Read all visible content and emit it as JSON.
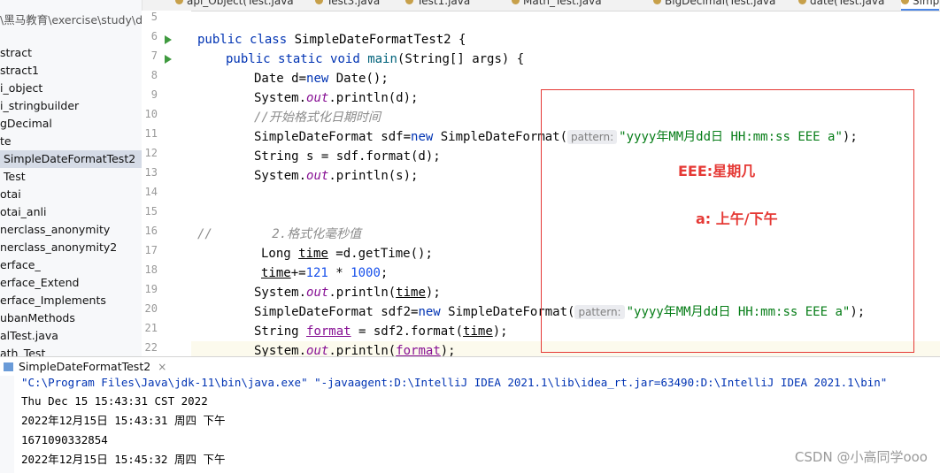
{
  "tabs": [
    {
      "label": "api_Object(Test.java"
    },
    {
      "label": "Test3.java"
    },
    {
      "label": "Test1.java"
    },
    {
      "label": "Math_Test.java"
    },
    {
      "label": "BigDecimal(Test.java"
    },
    {
      "label": "date(Test.java"
    },
    {
      "label": "Simp"
    }
  ],
  "tree": {
    "path": "\\黑马教育\\exercise\\study\\da",
    "items": [
      {
        "label": "stract"
      },
      {
        "label": "stract1"
      },
      {
        "label": "i_object"
      },
      {
        "label": "i_stringbuilder"
      },
      {
        "label": "gDecimal"
      },
      {
        "label": "te"
      },
      {
        "label": "SimpleDateFormatTest2",
        "selected": true
      },
      {
        "label": "Test"
      },
      {
        "label": "otai"
      },
      {
        "label": "otai_anli"
      },
      {
        "label": "nerclass_anonymity"
      },
      {
        "label": "nerclass_anonymity2"
      },
      {
        "label": "erface_"
      },
      {
        "label": "erface_Extend"
      },
      {
        "label": "erface_Implements"
      },
      {
        "label": "ubanMethods"
      },
      {
        "label": "alTest.java"
      },
      {
        "label": "ath_Test"
      }
    ]
  },
  "gutter": {
    "line_numbers": [
      "5",
      "6",
      "7",
      "8",
      "9",
      "10",
      "11",
      "12",
      "13",
      "14",
      "15",
      "16",
      "17",
      "18",
      "19",
      "20",
      "21",
      "22"
    ]
  },
  "code": {
    "l6": {
      "kw1": "public",
      "kw2": "class",
      "name": "SimpleDateFormatTest2",
      "brace": " {"
    },
    "l7": {
      "kw1": "public",
      "kw2": "static",
      "kw3": "void",
      "fn": "main",
      "rest": "(String[] args) {"
    },
    "l8": {
      "a": "Date d=",
      "kw": "new",
      "b": " Date();"
    },
    "l9": {
      "a": "System.",
      "f": "out",
      "b": ".println(d);"
    },
    "l10": {
      "cm": "//开始格式化日期时间"
    },
    "l11": {
      "a": "SimpleDateFormat sdf=",
      "kw": "new",
      "b": " SimpleDateFormat(",
      "hint": "pattern:",
      "s": "\"yyyy年MM月dd日 HH:mm:ss EEE a\"",
      "c": ");"
    },
    "l12": {
      "a": "String s = sdf.format(d);"
    },
    "l13": {
      "a": "System.",
      "f": "out",
      "b": ".println(s);"
    },
    "l16": {
      "cm": "//        2.格式化毫秒值"
    },
    "l17": {
      "a": "Long ",
      "v": "time",
      "b": " =d.getTime();"
    },
    "l18": {
      "v": "time",
      "a": "+=",
      "n1": "121",
      "b": " * ",
      "n2": "1000",
      "c": ";"
    },
    "l19": {
      "a": "System.",
      "f": "out",
      "b": ".println(",
      "v": "time",
      "c": ");"
    },
    "l20": {
      "a": "SimpleDateFormat sdf2=",
      "kw": "new",
      "b": " SimpleDateFormat(",
      "hint": "pattern:",
      "s": "\"yyyy年MM月dd日 HH:mm:ss EEE a\"",
      "c": ");"
    },
    "l21": {
      "a": "String ",
      "v": "format",
      "b": " = sdf2.format(",
      "v2": "time",
      "c": ");"
    },
    "l22": {
      "a": "System.",
      "f": "out",
      "b": ".println(",
      "v": "format",
      "c": ");"
    }
  },
  "annotation": {
    "line1": "EEE:星期几",
    "line2": "a:  上午/下午",
    "color": "#e53935"
  },
  "run": {
    "tab_label": "SimpleDateFormatTest2",
    "tab_close": "×",
    "lines": [
      "\"C:\\Program Files\\Java\\jdk-11\\bin\\java.exe\" \"-javaagent:D:\\IntelliJ IDEA 2021.1\\lib\\idea_rt.jar=63490:D:\\IntelliJ IDEA 2021.1\\bin\"",
      "Thu Dec 15 15:43:31 CST 2022",
      "2022年12月15日 15:43:31 周四 下午",
      "1671090332854",
      "2022年12月15日 15:45:32 周四 下午"
    ]
  },
  "watermark": "CSDN @小高同学ooo"
}
